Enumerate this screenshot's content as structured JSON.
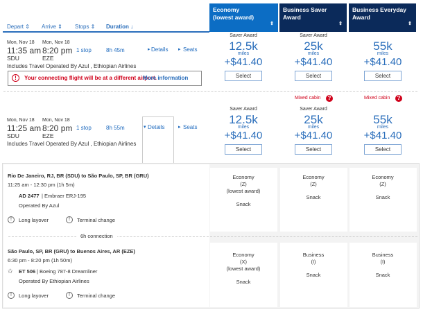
{
  "columns": [
    {
      "title": "Economy",
      "subtitle": "(lowest award)",
      "color": "#0c6dc4"
    },
    {
      "title": "Business Saver Award",
      "color": "#0b2a5a"
    },
    {
      "title": "Business Everyday Award",
      "color": "#0b2a5a"
    }
  ],
  "sort": {
    "depart": "Depart ⇕",
    "arrive": "Arrive ⇕",
    "stops": "Stops ⇕",
    "duration": "Duration ↓"
  },
  "flights": [
    {
      "dep_date": "Mon, Nov 18",
      "dep_time": "11:35 am",
      "dep_airport": "SDU",
      "arr_date": "Mon, Nov 18",
      "arr_time": "8:20 pm",
      "arr_airport": "EZE",
      "stops": "1 stop",
      "duration": "8h 45m",
      "details": "Details",
      "seats": "Seats",
      "operated": "Includes Travel Operated By Azul , Ethiopian Airlines",
      "warning": "Your connecting flight will be at a different airport.",
      "warning_link": "More information",
      "fares": [
        {
          "tag": "Saver Award",
          "miles": "12.5k",
          "unit": "miles",
          "price": "+$41.40",
          "select": "Select"
        },
        {
          "tag": "Saver Award",
          "miles": "25k",
          "unit": "miles",
          "price": "+$41.40",
          "select": "Select"
        },
        {
          "tag": "",
          "miles": "55k",
          "unit": "miles",
          "price": "+$41.40",
          "select": "Select"
        }
      ]
    },
    {
      "dep_date": "Mon, Nov 18",
      "dep_time": "11:25 am",
      "dep_airport": "SDU",
      "arr_date": "Mon, Nov 18",
      "arr_time": "8:20 pm",
      "arr_airport": "EZE",
      "stops": "1 stop",
      "duration": "8h 55m",
      "details": "Details",
      "seats": "Seats",
      "operated": "Includes Travel Operated By Azul , Ethiopian Airlines",
      "mixed": [
        "",
        "Mixed cabin",
        "Mixed cabin"
      ],
      "fares": [
        {
          "tag": "Saver Award",
          "miles": "12.5k",
          "unit": "miles",
          "price": "+$41.40",
          "select": "Select"
        },
        {
          "tag": "Saver Award",
          "miles": "25k",
          "unit": "miles",
          "price": "+$41.40",
          "select": "Select"
        },
        {
          "tag": "",
          "miles": "55k",
          "unit": "miles",
          "price": "+$41.40",
          "select": "Select"
        }
      ]
    }
  ],
  "segments": [
    {
      "route": "Rio De Janeiro, RJ, BR (SDU) to São Paulo, SP, BR (GRU)",
      "times": "11:25 am - 12:30 pm (1h 5m)",
      "flight": "AD 2477",
      "aircraft": "| Embraer ERJ-195",
      "operated": "Operated By Azul",
      "notes": [
        "Long layover",
        "Terminal change"
      ],
      "cabins": [
        {
          "cabin": "Economy",
          "code": "(Z)",
          "extra": "(lowest award)",
          "meal": "Snack"
        },
        {
          "cabin": "Economy",
          "code": "(Z)",
          "extra": "",
          "meal": "Snack"
        },
        {
          "cabin": "Economy",
          "code": "(Z)",
          "extra": "",
          "meal": "Snack"
        }
      ]
    },
    {
      "route": "São Paulo, SP, BR (GRU) to Buenos Aires, AR (EZE)",
      "times": "6:30 pm - 8:20 pm (1h 50m)",
      "flight": "ET 506",
      "aircraft": "| Boeing 787-8 Dreamliner",
      "operated": "Operated By Ethiopian Airlines",
      "notes": [
        "Long layover",
        "Terminal change"
      ],
      "cabins": [
        {
          "cabin": "Economy",
          "code": "(X)",
          "extra": "(lowest award)",
          "meal": "Snack"
        },
        {
          "cabin": "Business",
          "code": "(I)",
          "extra": "",
          "meal": "Snack"
        },
        {
          "cabin": "Business",
          "code": "(I)",
          "extra": "",
          "meal": "Snack"
        }
      ]
    }
  ],
  "connection": "6h connection"
}
